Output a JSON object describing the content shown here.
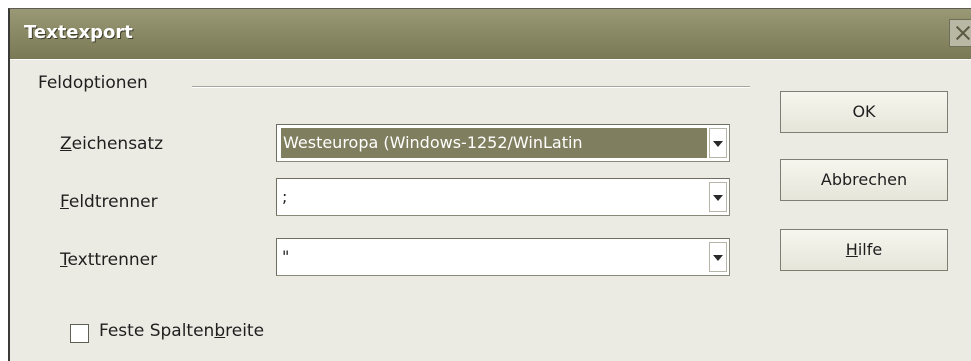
{
  "window": {
    "title": "Textexport"
  },
  "group": {
    "label": "Feldoptionen"
  },
  "fields": {
    "charset": {
      "label_mnemonic": "Z",
      "label_rest": "eichensatz",
      "value": "Westeuropa (Windows-1252/WinLatin"
    },
    "field_separator": {
      "label_mnemonic": "F",
      "label_rest": "eldtrenner",
      "value": ";"
    },
    "text_separator": {
      "label_mnemonic": "T",
      "label_rest": "exttrenner",
      "value": "\""
    }
  },
  "checkbox": {
    "label_pre": "Feste Spalten",
    "label_mnemonic": "b",
    "label_post": "reite",
    "checked": false
  },
  "buttons": {
    "ok": "OK",
    "cancel": "Abbrechen",
    "help_mnemonic": "H",
    "help_rest": "ilfe"
  },
  "colors": {
    "titlebar": "#8b8a66",
    "selection": "#7f7e5e",
    "dialog_bg": "#ecebe3"
  },
  "icons": {
    "close": "close-icon",
    "dropdown": "chevron-down-icon"
  }
}
